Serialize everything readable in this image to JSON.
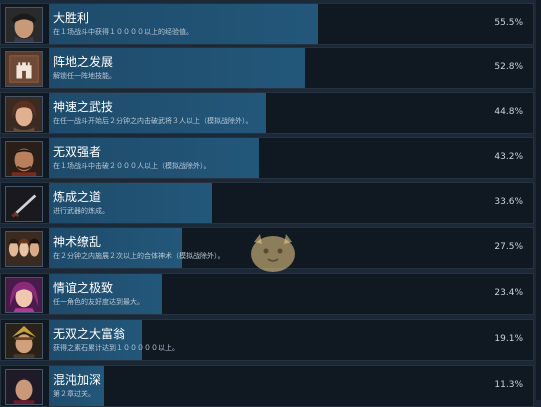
{
  "achievements": [
    {
      "title": "大胜利",
      "description": "在１场战斗中获得１００００以上的经验值。",
      "percent": "55.5%",
      "progress": 0.555,
      "icon": "warrior-portrait-icon"
    },
    {
      "title": "阵地之发展",
      "description": "解锁任一阵地技能。",
      "percent": "52.8%",
      "progress": 0.528,
      "icon": "castle-icon"
    },
    {
      "title": "神速之武技",
      "description": "在任一战斗开始后２分钟之内击破武将３人以上（模拟战除外）。",
      "percent": "44.8%",
      "progress": 0.448,
      "icon": "warrior-portrait-icon"
    },
    {
      "title": "无双强者",
      "description": "在１场战斗中击破２０００人以上（模拟战除外）。",
      "percent": "43.2%",
      "progress": 0.432,
      "icon": "warrior-portrait-icon"
    },
    {
      "title": "炼成之道",
      "description": "进行武器的炼成。",
      "percent": "33.6%",
      "progress": 0.336,
      "icon": "sword-icon"
    },
    {
      "title": "神术缭乱",
      "description": "在２分钟之内施展２次以上的合体神术（模拟战除外）。",
      "percent": "27.5%",
      "progress": 0.275,
      "icon": "group-portrait-icon"
    },
    {
      "title": "情谊之极致",
      "description": "任一角色的友好度达到最大。",
      "percent": "23.4%",
      "progress": 0.234,
      "icon": "female-portrait-icon"
    },
    {
      "title": "无双之大富翁",
      "description": "获得之素石累计达到１０００００以上。",
      "percent": "19.1%",
      "progress": 0.191,
      "icon": "warrior-portrait-icon"
    },
    {
      "title": "混沌加深",
      "description": "第２章过关。",
      "percent": "11.3%",
      "progress": 0.113,
      "icon": "warrior-portrait-icon"
    }
  ]
}
